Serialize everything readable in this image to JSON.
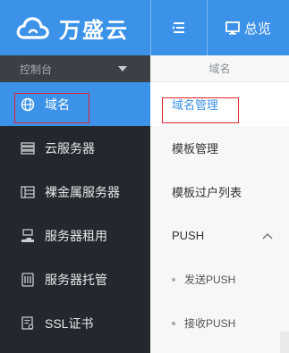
{
  "brand": {
    "name": "万盛云"
  },
  "topbar": {
    "overview_label": "总览"
  },
  "sidebar": {
    "header_label": "控制台",
    "items": [
      {
        "label": "域名",
        "icon": "globe-icon",
        "active": true
      },
      {
        "label": "云服务器",
        "icon": "server-stack-icon"
      },
      {
        "label": "裸金属服务器",
        "icon": "server-rack-icon"
      },
      {
        "label": "服务器租用",
        "icon": "hand-server-icon"
      },
      {
        "label": "服务器托管",
        "icon": "managed-server-icon"
      },
      {
        "label": "SSL证书",
        "icon": "certificate-icon"
      }
    ]
  },
  "subpanel": {
    "header_label": "域名",
    "items": [
      {
        "label": "域名管理",
        "active": true
      },
      {
        "label": "模板管理"
      },
      {
        "label": "模板过户列表"
      }
    ],
    "group": {
      "label": "PUSH",
      "children": [
        "发送PUSH",
        "接收PUSH"
      ]
    }
  },
  "colors": {
    "accent": "#3b92e8",
    "sidebar_bg": "#22282e",
    "highlight_border": "#e0252b"
  }
}
